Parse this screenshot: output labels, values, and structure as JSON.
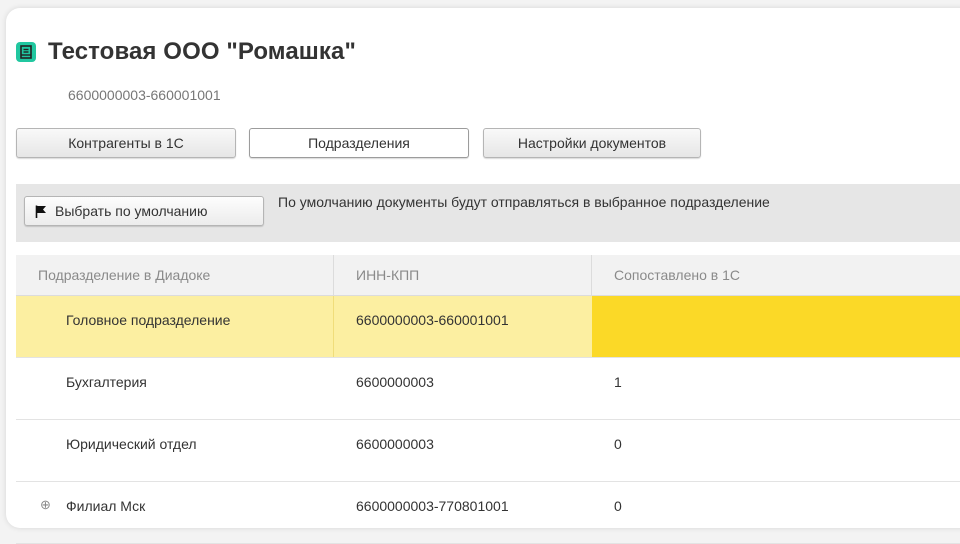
{
  "header": {
    "title": "Тестовая ООО \"Ромашка\"",
    "subtitle": "6600000003-660001001",
    "icon": "document-icon",
    "icon_color": "#21c7a0"
  },
  "tabs": [
    {
      "label": "Контрагенты в 1С",
      "active": false
    },
    {
      "label": "Подразделения",
      "active": true
    },
    {
      "label": "Настройки документов",
      "active": false
    }
  ],
  "info_bar": {
    "default_button_label": "Выбрать по умолчанию",
    "default_button_icon": "flag-icon",
    "text": "По умолчанию документы будут отправляться  в выбранное подразделение"
  },
  "table": {
    "columns": [
      "Подразделение в Диадоке",
      "ИНН-КПП",
      "Сопоставлено в 1С"
    ],
    "rows": [
      {
        "name": "Головное подразделение",
        "inn_kpp": "6600000003-660001001",
        "matched": "",
        "selected": true,
        "expandable": false
      },
      {
        "name": "Бухгалтерия",
        "inn_kpp": "6600000003",
        "matched": "1",
        "selected": false,
        "expandable": false
      },
      {
        "name": "Юридический отдел",
        "inn_kpp": "6600000003",
        "matched": "0",
        "selected": false,
        "expandable": false
      },
      {
        "name": "Филиал Мск",
        "inn_kpp": "6600000003-770801001",
        "matched": "0",
        "selected": false,
        "expandable": true
      }
    ],
    "selected_row_color": "#fcefa1",
    "selected_cell_color": "#fbd927"
  }
}
